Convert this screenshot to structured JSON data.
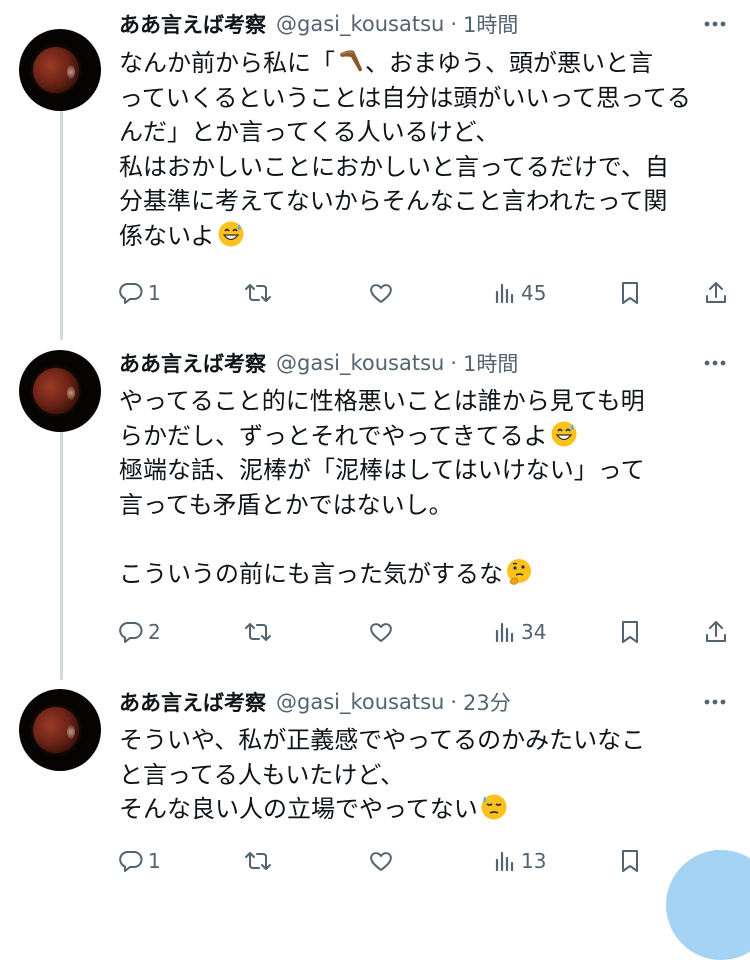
{
  "tweets": [
    {
      "display_name": "ああ言えば考察",
      "handle": "@gasi_kousatsu",
      "separator": "·",
      "time": "1時間",
      "lines": [
        "なんか前から私に「",
        "っていくるということは自分は頭がいいって思ってる",
        "んだ」とか言ってくる人いるけど、",
        "私はおかしいことにおかしいと言ってるだけで、自",
        "分基準に考えてないからそんなこと言われたって関",
        "係ないよ"
      ],
      "line1_after_emoji": "、おまゆう、頭が悪いと言",
      "emojis": [
        "boomerang",
        "grinning-sweat"
      ],
      "stats": {
        "replies": "1",
        "retweets": "",
        "likes": "",
        "views": "45"
      }
    },
    {
      "display_name": "ああ言えば考察",
      "handle": "@gasi_kousatsu",
      "separator": "·",
      "time": "1時間",
      "lines": [
        "やってること的に性格悪いことは誰から見ても明",
        "らかだし、ずっとそれでやってきてるよ",
        "極端な話、泥棒が「泥棒はしてはいけない」って",
        "言っても矛盾とかではないし。",
        "",
        "こういうの前にも言った気がするな"
      ],
      "emojis": [
        "grinning-sweat",
        "thinking-face"
      ],
      "stats": {
        "replies": "2",
        "retweets": "",
        "likes": "",
        "views": "34"
      }
    },
    {
      "display_name": "ああ言えば考察",
      "handle": "@gasi_kousatsu",
      "separator": "·",
      "time": "23分",
      "lines": [
        "そういや、私が正義感でやってるのかみたいなこ",
        "と言ってる人もいたけど、",
        "そんな良い人の立場でやってない"
      ],
      "emojis": [
        "downcast-sweat"
      ],
      "stats": {
        "replies": "1",
        "retweets": "",
        "likes": "",
        "views": "13"
      }
    }
  ],
  "icons": {
    "avatar": "eclipse-moon-avatar",
    "more": "more-horizontal-icon",
    "reply": "reply-icon",
    "retweet": "retweet-icon",
    "like": "heart-icon",
    "views": "bar-chart-icon",
    "bookmark": "bookmark-icon",
    "share": "share-icon"
  },
  "colors": {
    "text": "#0f1419",
    "secondary": "#536471",
    "thread_line": "#cfd9de",
    "compose_fab": "#a5d3f3"
  }
}
